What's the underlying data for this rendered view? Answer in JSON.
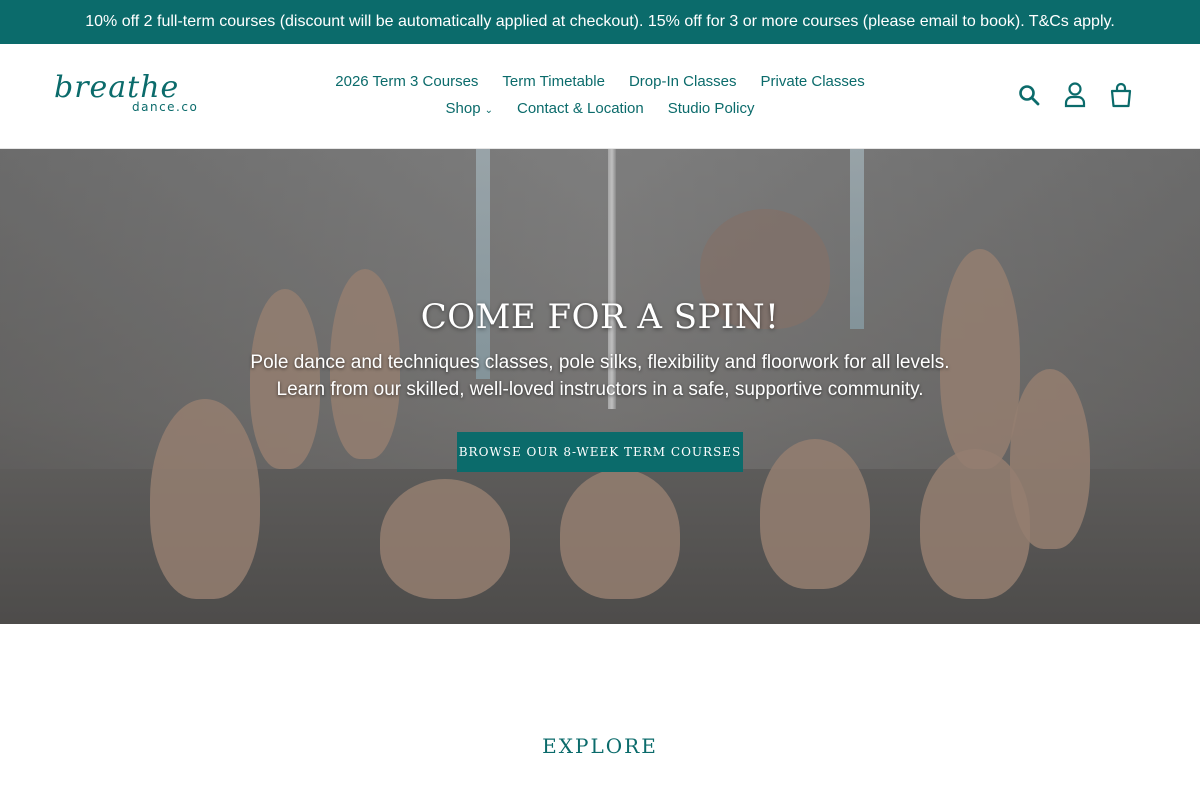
{
  "announcement": {
    "text": "10% off 2 full-term courses (discount will be automatically applied at checkout). 15% off for 3 or more courses (please email to book). T&Cs apply."
  },
  "logo": {
    "script": "breathe",
    "sub": "dance.co"
  },
  "nav": {
    "row1": [
      "2026 Term 3 Courses",
      "Term Timetable",
      "Drop-In Classes",
      "Private Classes"
    ],
    "row2": [
      "Shop",
      "Contact & Location",
      "Studio Policy"
    ]
  },
  "icons": {
    "search": "search-icon",
    "account": "account-icon",
    "cart": "cart-icon"
  },
  "hero": {
    "title": "COME FOR A SPIN!",
    "line1": "Pole dance and techniques classes, pole silks, flexibility and floorwork for all levels.",
    "line2": "Learn from our skilled, well-loved instructors in a safe, supportive community.",
    "cta": "BROWSE OUR 8-WEEK TERM COURSES"
  },
  "section": {
    "title": "EXPLORE"
  },
  "colors": {
    "brand": "#0b6b6b",
    "white": "#ffffff"
  }
}
